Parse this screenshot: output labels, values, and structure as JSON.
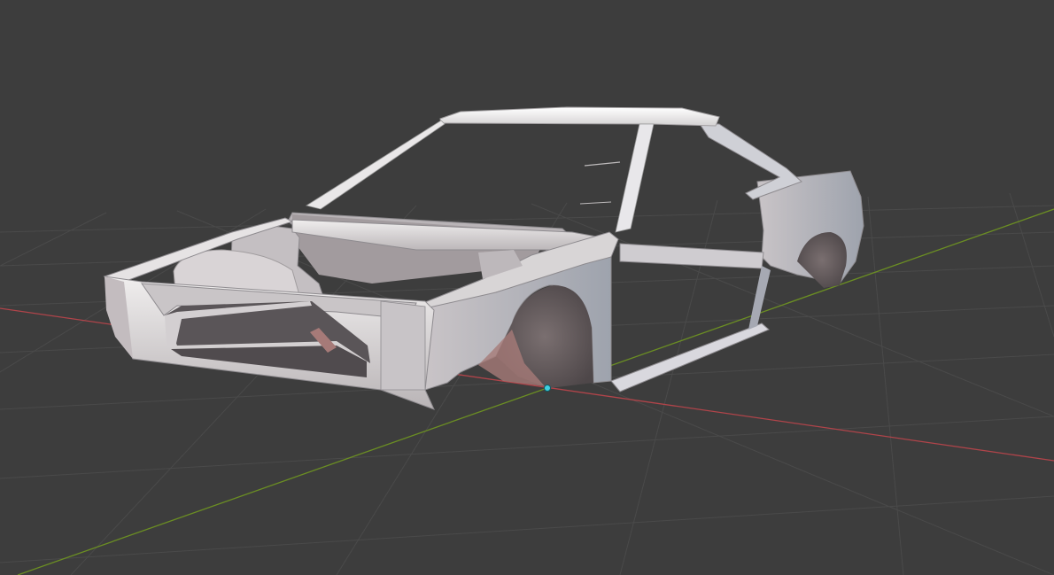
{
  "viewport": {
    "background_color": "#3d3d3d",
    "grid_color": "#4a4a4a",
    "x_axis_color": "#b0444a",
    "y_axis_color": "#6b8e23",
    "origin_color": "#3fd0e0"
  },
  "model": {
    "body_color": "#d8d5d6",
    "shadow_color": "#8e8b8f",
    "inner_color": "#6e6a6d",
    "accent_red": "#a67a78"
  }
}
